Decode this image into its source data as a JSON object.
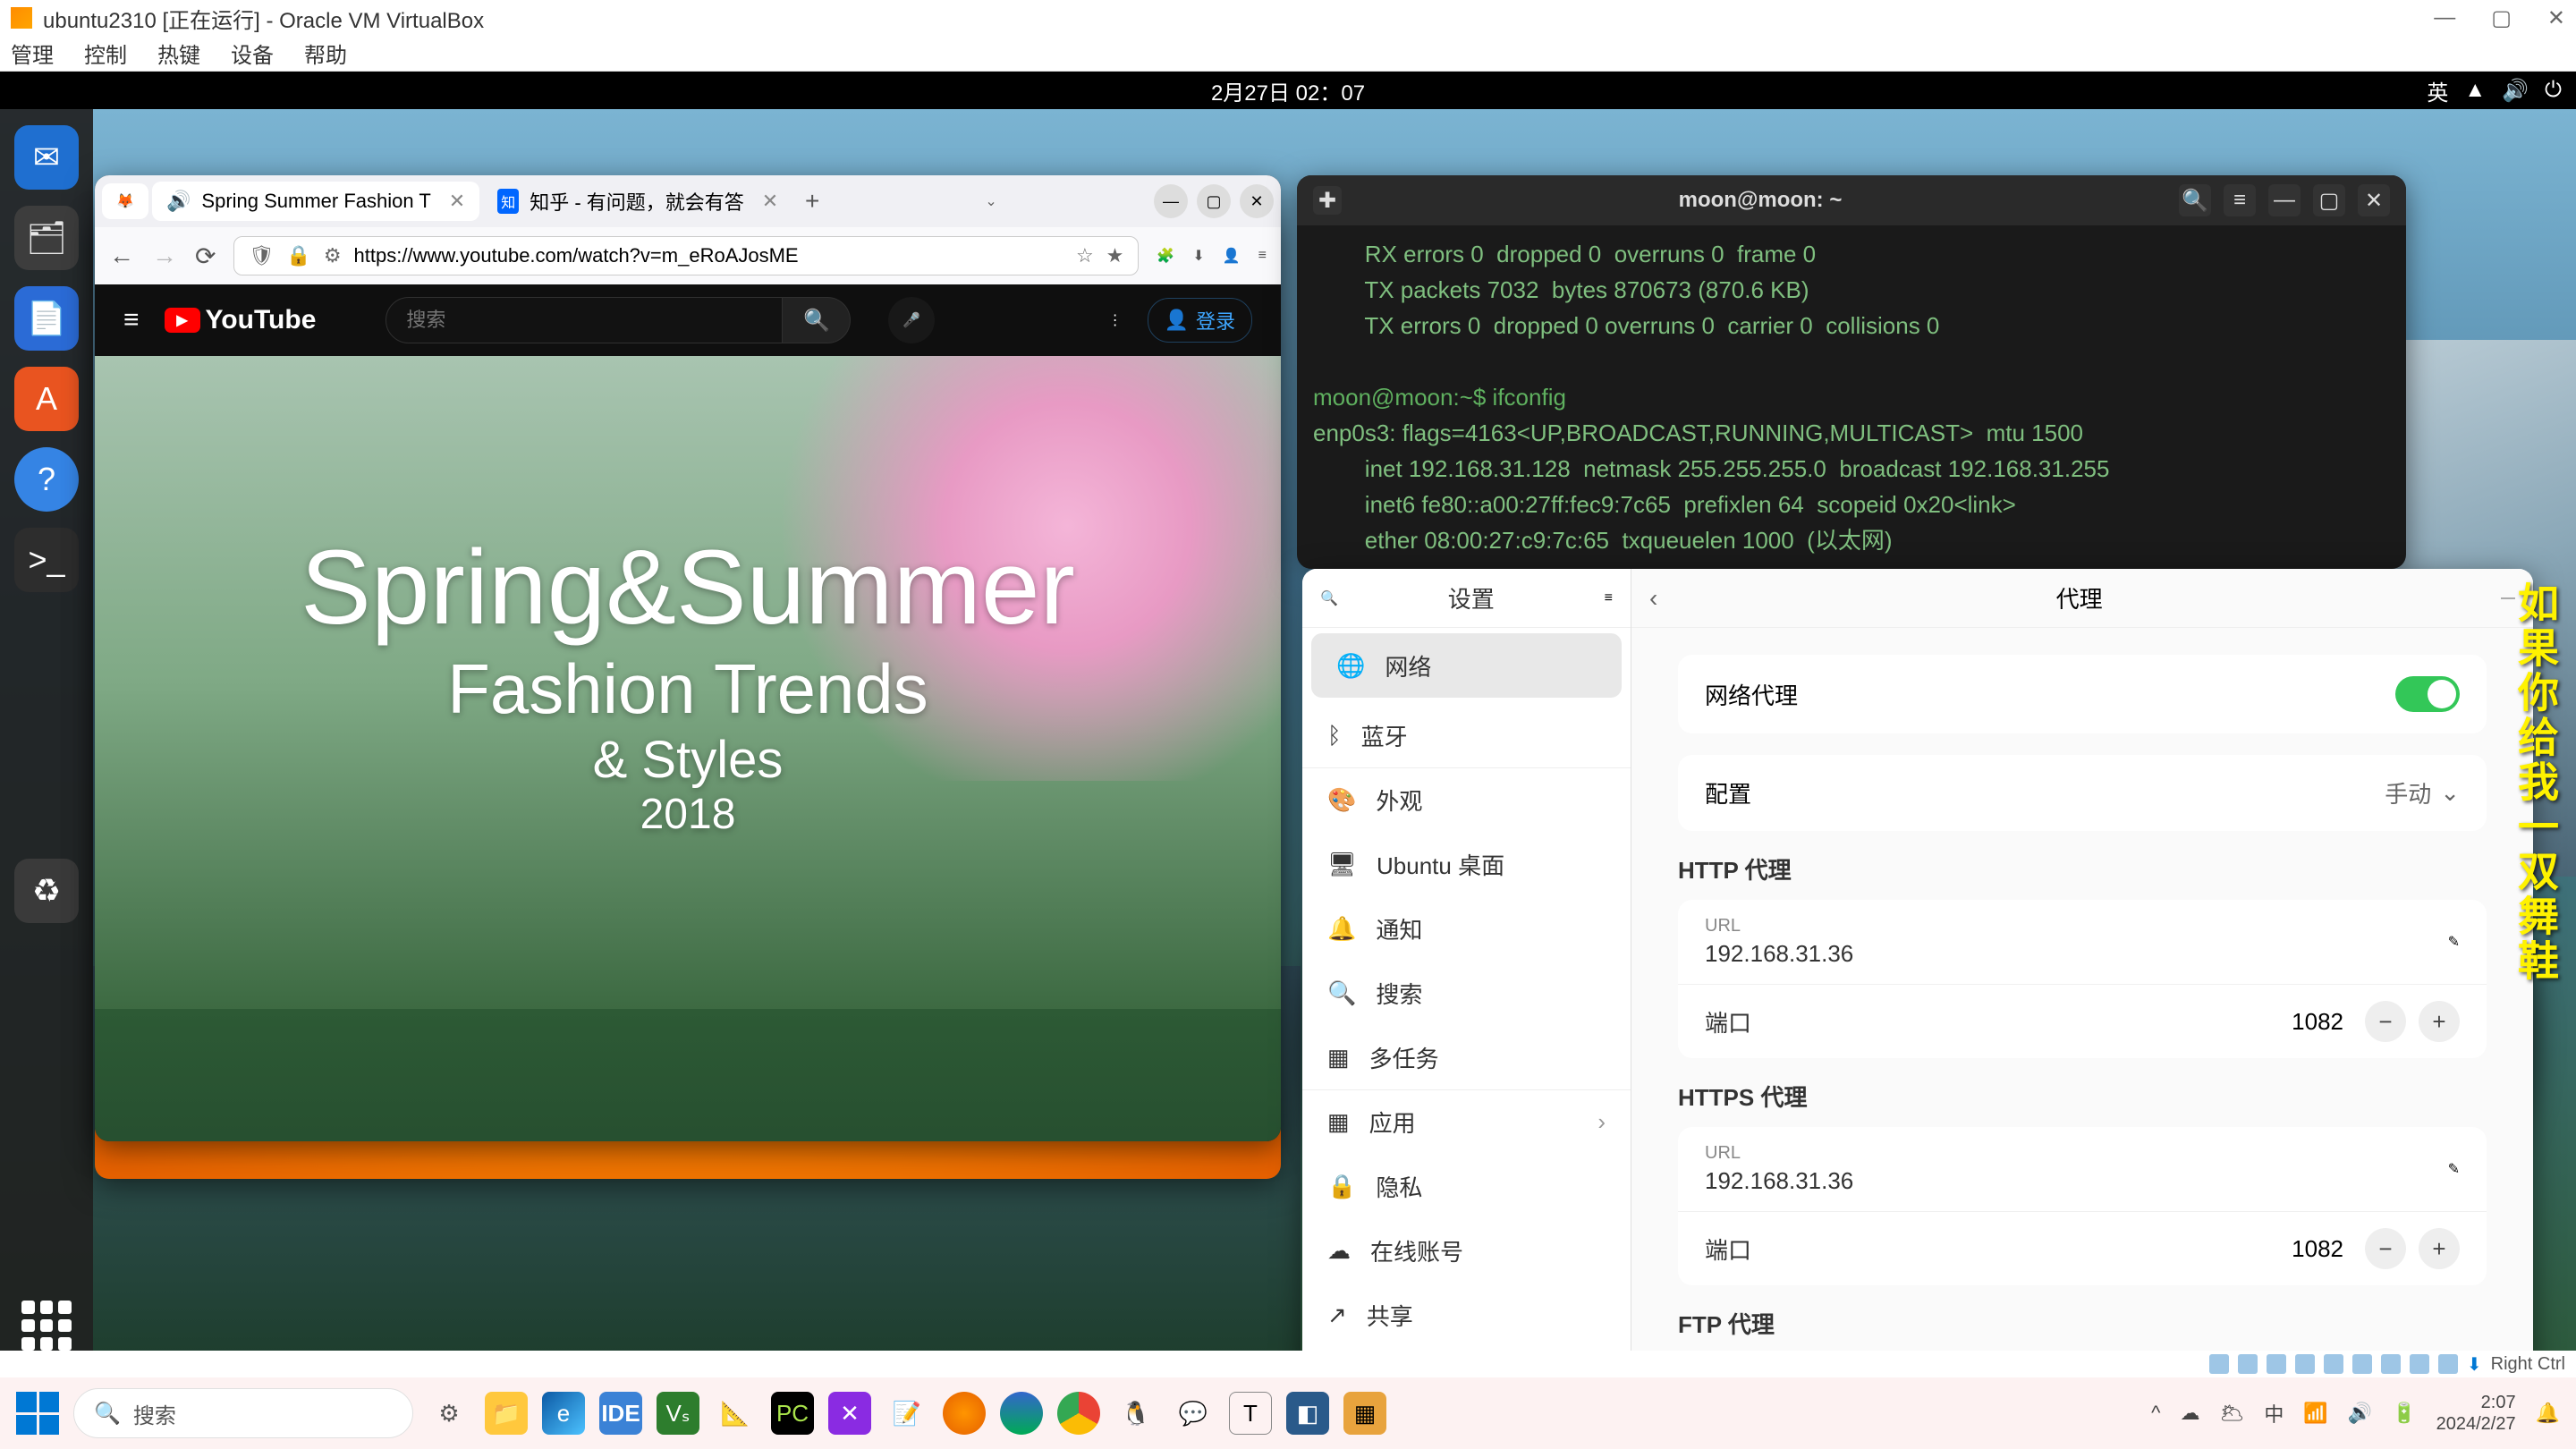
{
  "vbox": {
    "title": "ubuntu2310 [正在运行] - Oracle VM VirtualBox",
    "menu": [
      "管理",
      "控制",
      "热键",
      "设备",
      "帮助"
    ],
    "status_key": "Right Ctrl"
  },
  "ubuntu_topbar": {
    "datetime": "2月27日 02：07",
    "lang": "英"
  },
  "firefox": {
    "tabs": [
      {
        "icon": "sound-icon",
        "title": "Spring Summer Fashion T"
      },
      {
        "icon": "zhihu-icon",
        "title": "知乎 - 有问题，就会有答"
      }
    ],
    "url": "https://www.youtube.com/watch?v=m_eRoAJosME"
  },
  "youtube": {
    "logo": "YouTube",
    "search_placeholder": "搜索",
    "login": "登录",
    "overlay": {
      "l1": "Spring&Summer",
      "l2": "Fashion Trends",
      "l3": "& Styles",
      "l4": "2018"
    }
  },
  "terminal": {
    "title": "moon@moon: ~",
    "lines": [
      "        RX errors 0  dropped 0  overruns 0  frame 0",
      "        TX packets 7032  bytes 870673 (870.6 KB)",
      "        TX errors 0  dropped 0 overruns 0  carrier 0  collisions 0",
      "",
      "moon@moon:~$ ifconfig",
      "enp0s3: flags=4163<UP,BROADCAST,RUNNING,MULTICAST>  mtu 1500",
      "        inet 192.168.31.128  netmask 255.255.255.0  broadcast 192.168.31.255",
      "        inet6 fe80::a00:27ff:fec9:7c65  prefixlen 64  scopeid 0x20<link>",
      "        ether 08:00:27:c9:7c:65  txqueuelen 1000  (以太网)"
    ]
  },
  "settings": {
    "side_title": "设置",
    "items": [
      "网络",
      "蓝牙",
      "外观",
      "Ubuntu 桌面",
      "通知",
      "搜索",
      "多任务",
      "应用",
      "隐私",
      "在线账号",
      "共享"
    ],
    "main_title": "代理",
    "proxy_label": "网络代理",
    "config_label": "配置",
    "config_value": "手动",
    "sections": {
      "http": {
        "title": "HTTP 代理",
        "url_label": "URL",
        "url": "192.168.31.36",
        "port_label": "端口",
        "port": "1082"
      },
      "https": {
        "title": "HTTPS 代理",
        "url_label": "URL",
        "url": "192.168.31.36",
        "port_label": "端口",
        "port": "1082"
      },
      "ftp": {
        "title": "FTP 代理"
      }
    }
  },
  "desktop_text": "如果你给我一双舞鞋",
  "windows": {
    "search": "搜索",
    "time": "2:07",
    "date": "2024/2/27",
    "ime": "中"
  }
}
